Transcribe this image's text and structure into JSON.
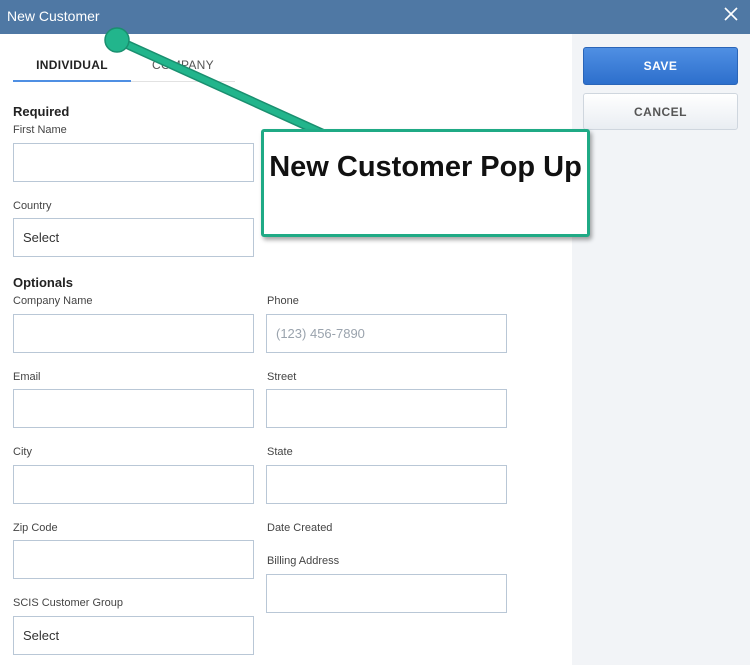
{
  "window": {
    "title": "New Customer",
    "close_icon": "close-icon"
  },
  "actions": {
    "save_label": "SAVE",
    "cancel_label": "CANCEL"
  },
  "tabs": [
    {
      "label": "INDIVIDUAL",
      "active": true
    },
    {
      "label": "COMPANY",
      "active": false
    }
  ],
  "required": {
    "heading": "Required",
    "first_name": {
      "label": "First Name",
      "value": ""
    },
    "country": {
      "label": "Country",
      "value": "Select"
    }
  },
  "optionals": {
    "heading": "Optionals",
    "company_name": {
      "label": "Company Name",
      "value": ""
    },
    "phone": {
      "label": "Phone",
      "placeholder": "(123) 456-7890"
    },
    "email": {
      "label": "Email",
      "value": ""
    },
    "street": {
      "label": "Street",
      "value": ""
    },
    "city": {
      "label": "City",
      "value": ""
    },
    "state": {
      "label": "State",
      "value": ""
    },
    "zip_code": {
      "label": "Zip Code",
      "value": ""
    },
    "date_created": {
      "label": "Date Created"
    },
    "billing_address": {
      "label": "Billing Address",
      "value": ""
    },
    "scis_customer_group": {
      "label": "SCIS Customer Group",
      "value": "Select"
    }
  },
  "annotation": {
    "text": "New Customer Pop Up"
  },
  "colors": {
    "titlebar": "#4f78a4",
    "primary": "#2d6fcc",
    "annotation": "#1faa85"
  }
}
